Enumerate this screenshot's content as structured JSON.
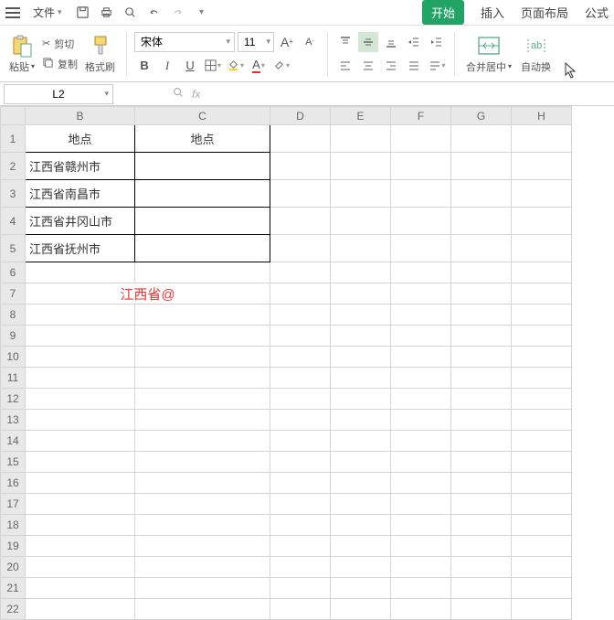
{
  "menubar": {
    "file": "文件",
    "tabs": {
      "start": "开始",
      "insert": "插入",
      "layout": "页面布局",
      "formula": "公式"
    }
  },
  "toolbar": {
    "paste": "粘贴",
    "cut": "剪切",
    "copy": "复制",
    "format_painter": "格式刷",
    "font_name": "宋体",
    "font_size": "11",
    "merge_center": "合并居中",
    "wrap": "自动换"
  },
  "namebox": {
    "ref": "L2"
  },
  "columns": [
    "B",
    "C",
    "D",
    "E",
    "F",
    "G",
    "H"
  ],
  "rows": [
    "1",
    "2",
    "3",
    "4",
    "5",
    "6",
    "7",
    "8",
    "9",
    "10",
    "11",
    "12",
    "13",
    "14",
    "15",
    "16",
    "17",
    "18",
    "19",
    "20",
    "21",
    "22"
  ],
  "cells": {
    "B1": "地点",
    "C1": "地点",
    "B2": "江西省赣州市",
    "B3": "江西省南昌市",
    "B4": "江西省井冈山市",
    "B5": "江西省抚州市",
    "B7": "江西省@"
  }
}
